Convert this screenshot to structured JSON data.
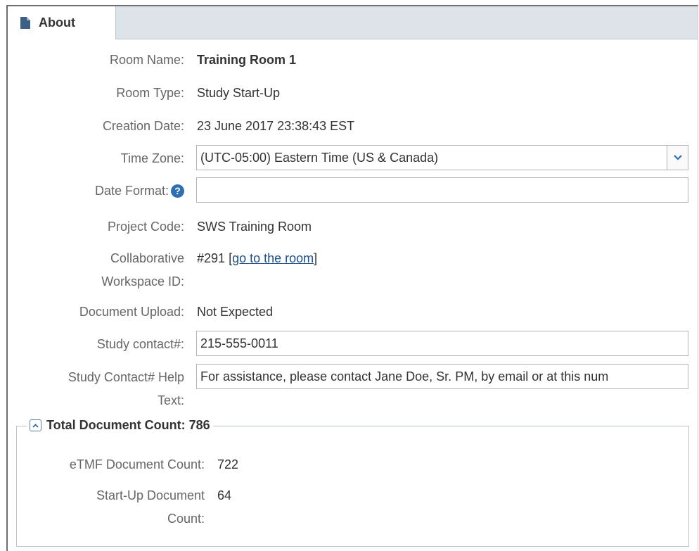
{
  "tab": {
    "label": "About",
    "icon": "document-icon"
  },
  "fields": {
    "room_name": {
      "label": "Room Name:",
      "value": "Training Room 1"
    },
    "room_type": {
      "label": "Room Type:",
      "value": "Study Start-Up"
    },
    "creation_date": {
      "label": "Creation Date:",
      "value": "23 June 2017 23:38:43 EST"
    },
    "time_zone": {
      "label": "Time Zone:",
      "value": "(UTC-05:00) Eastern Time (US & Canada)"
    },
    "date_format": {
      "label": "Date Format:",
      "value": "",
      "help_icon": "question-circle-icon"
    },
    "project_code": {
      "label": "Project Code:",
      "value": "SWS Training Room"
    },
    "workspace_id": {
      "label_line1": "Collaborative",
      "label_line2": "Workspace ID:",
      "value": "#291",
      "bracket_open": "[",
      "link": "go to the room",
      "bracket_close": "]"
    },
    "document_upload": {
      "label": "Document Upload:",
      "value": "Not Expected"
    },
    "study_contact": {
      "label": "Study contact#:",
      "value": "215-555-0011"
    },
    "study_contact_help": {
      "label_line1": "Study Contact# Help",
      "label_line2": "Text:",
      "value": "For assistance, please contact Jane Doe, Sr. PM, by email or at this num"
    }
  },
  "document_count": {
    "title": "Total Document Count: 786",
    "etmf": {
      "label": "eTMF Document Count:",
      "value": "722"
    },
    "startup": {
      "label_line1": "Start-Up Document",
      "label_line2": "Count:",
      "value": "64"
    }
  },
  "colors": {
    "accent": "#2f6db5",
    "tab_bar": "#dde3e9",
    "link": "#1f4e8c"
  }
}
